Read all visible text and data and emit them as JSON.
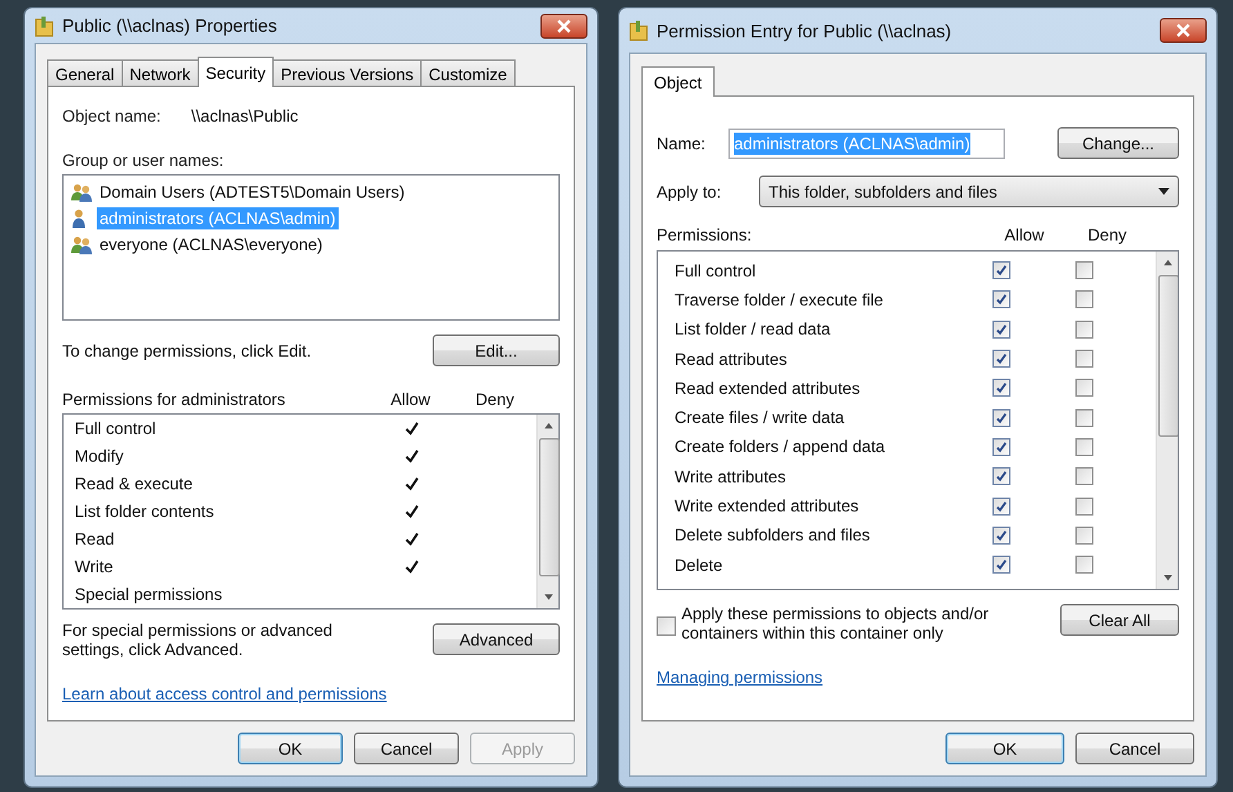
{
  "properties_dialog": {
    "title": "Public (\\\\aclnas) Properties",
    "tabs": [
      {
        "label": "General",
        "selected": false
      },
      {
        "label": "Network",
        "selected": false
      },
      {
        "label": "Security",
        "selected": true
      },
      {
        "label": "Previous Versions",
        "selected": false
      },
      {
        "label": "Customize",
        "selected": false
      }
    ],
    "object_name_label": "Object name:",
    "object_name": "\\\\aclnas\\Public",
    "group_label": "Group or user names:",
    "users": [
      {
        "name": "Domain Users (ADTEST5\\Domain Users)",
        "kind": "group",
        "selected": false
      },
      {
        "name": "administrators (ACLNAS\\admin)",
        "kind": "user",
        "selected": true
      },
      {
        "name": "everyone (ACLNAS\\everyone)",
        "kind": "group",
        "selected": false
      }
    ],
    "change_hint": "To change permissions, click Edit.",
    "edit_button": "Edit...",
    "permissions_label": "Permissions for administrators",
    "allow_header": "Allow",
    "deny_header": "Deny",
    "permissions": [
      {
        "name": "Full control",
        "allow": true,
        "deny": false
      },
      {
        "name": "Modify",
        "allow": true,
        "deny": false
      },
      {
        "name": "Read & execute",
        "allow": true,
        "deny": false
      },
      {
        "name": "List folder contents",
        "allow": true,
        "deny": false
      },
      {
        "name": "Read",
        "allow": true,
        "deny": false
      },
      {
        "name": "Write",
        "allow": true,
        "deny": false
      },
      {
        "name": "Special permissions",
        "allow": false,
        "deny": false
      }
    ],
    "advanced_hint": "For special permissions or advanced settings, click Advanced.",
    "advanced_button": "Advanced",
    "link": "Learn about access control and permissions",
    "buttons": [
      {
        "label": "OK",
        "default": true,
        "disabled": false
      },
      {
        "label": "Cancel",
        "default": false,
        "disabled": false
      },
      {
        "label": "Apply",
        "default": false,
        "disabled": true
      }
    ]
  },
  "entry_dialog": {
    "title": "Permission Entry for Public (\\\\aclnas)",
    "tabs": [
      {
        "label": "Object",
        "selected": true
      }
    ],
    "name_label": "Name:",
    "name_value": "administrators (ACLNAS\\admin)",
    "change_button": "Change...",
    "apply_to_label": "Apply to:",
    "apply_to_value": "This folder, subfolders and files",
    "permissions_label": "Permissions:",
    "allow_header": "Allow",
    "deny_header": "Deny",
    "permissions": [
      {
        "name": "Full control",
        "allow": true,
        "deny": false
      },
      {
        "name": "Traverse folder / execute file",
        "allow": true,
        "deny": false
      },
      {
        "name": "List folder / read data",
        "allow": true,
        "deny": false
      },
      {
        "name": "Read attributes",
        "allow": true,
        "deny": false
      },
      {
        "name": "Read extended attributes",
        "allow": true,
        "deny": false
      },
      {
        "name": "Create files / write data",
        "allow": true,
        "deny": false
      },
      {
        "name": "Create folders / append data",
        "allow": true,
        "deny": false
      },
      {
        "name": "Write attributes",
        "allow": true,
        "deny": false
      },
      {
        "name": "Write extended attributes",
        "allow": true,
        "deny": false
      },
      {
        "name": "Delete subfolders and files",
        "allow": true,
        "deny": false
      },
      {
        "name": "Delete",
        "allow": true,
        "deny": false
      }
    ],
    "apply_only": {
      "label": "Apply these permissions to objects and/or containers within this container only",
      "checked": false
    },
    "clear_all_button": "Clear All",
    "link": "Managing permissions",
    "buttons": [
      {
        "label": "OK",
        "default": true,
        "disabled": false
      },
      {
        "label": "Cancel",
        "default": false,
        "disabled": false
      }
    ]
  }
}
